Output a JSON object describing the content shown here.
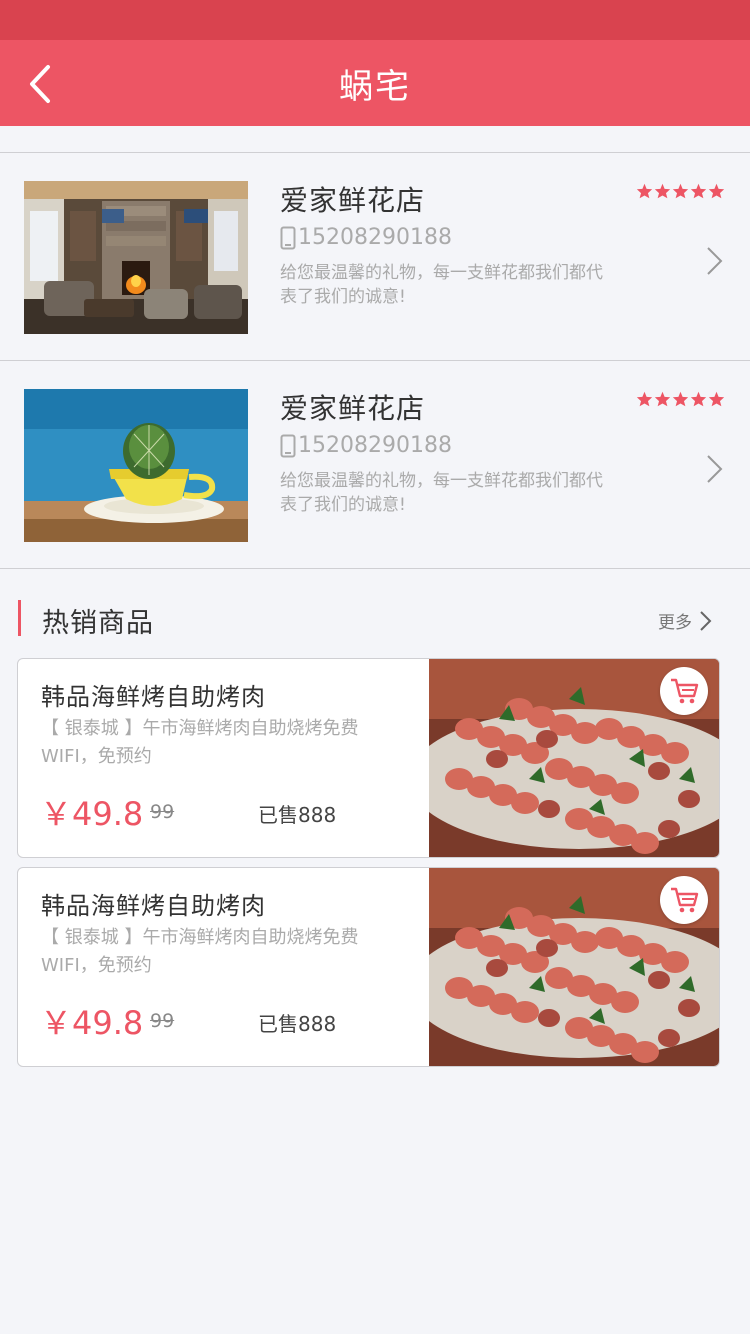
{
  "header": {
    "title": "蜗宅"
  },
  "shops": [
    {
      "name": "爱家鲜花店",
      "phone": "15208290188",
      "description": "给您最温馨的礼物，每一支鲜花都我们都代表了我们的诚意!",
      "rating": 5
    },
    {
      "name": "爱家鲜花店",
      "phone": "15208290188",
      "description": "给您最温馨的礼物，每一支鲜花都我们都代表了我们的诚意!",
      "rating": 5
    }
  ],
  "hot_section": {
    "title": "热销商品",
    "more_label": "更多"
  },
  "products": [
    {
      "title": "韩品海鲜烤自助烤肉",
      "description": "【 银泰城 】午市海鲜烤肉自助烧烤免费WIFI，免预约",
      "price": "￥49.8",
      "original_price": "99",
      "sold": "已售888"
    },
    {
      "title": "韩品海鲜烤自助烤肉",
      "description": "【 银泰城 】午市海鲜烤肉自助烧烤免费WIFI，免预约",
      "price": "￥49.8",
      "original_price": "99",
      "sold": "已售888"
    }
  ],
  "colors": {
    "accent": "#ed5564",
    "status_bar": "#d9434f",
    "background": "#f4f5f9"
  }
}
